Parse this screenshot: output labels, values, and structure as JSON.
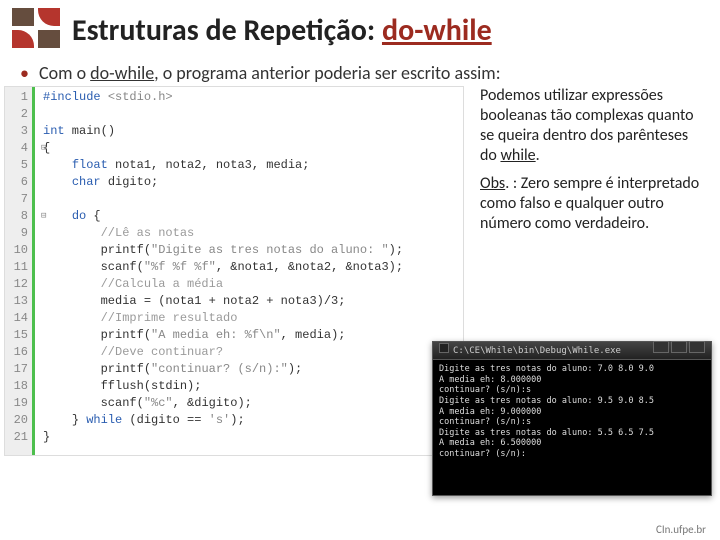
{
  "header": {
    "title_pre": "Estruturas de Repetição: ",
    "title_accent": "do-while"
  },
  "bullet": {
    "prefix": "Com o ",
    "kw": "do-while",
    "suffix": ", o programa anterior poderia ser escrito assim:"
  },
  "gutter": [
    "1",
    "2",
    "3",
    "4",
    "5",
    "6",
    "7",
    "8",
    "9",
    "10",
    "11",
    "12",
    "13",
    "14",
    "15",
    "16",
    "17",
    "18",
    "19",
    "20",
    "21"
  ],
  "code": {
    "l1a": "#include ",
    "l1b": "<stdio.h>",
    "l3": "int",
    "l3b": " main()",
    "l4": "{",
    "l5a": "float",
    "l5b": " nota1, nota2, nota3, media;",
    "l6a": "char",
    "l6b": " digito;",
    "l8a": "do",
    "l8b": " {",
    "l9": "//Lê as notas",
    "l10a": "printf(",
    "l10b": "\"Digite as tres notas do aluno: \"",
    "l10c": ");",
    "l11a": "scanf(",
    "l11b": "\"%f %f %f\"",
    "l11c": ", &nota1, &nota2, &nota3);",
    "l12": "//Calcula a média",
    "l13": "media = (nota1 + nota2 + nota3)/3;",
    "l14": "//Imprime resultado",
    "l15a": "printf(",
    "l15b": "\"A media eh: %f\\n\"",
    "l15c": ", media);",
    "l16": "//Deve continuar?",
    "l17a": "printf(",
    "l17b": "\"continuar? (s/n):\"",
    "l17c": ");",
    "l18": "fflush(stdin);",
    "l19a": "scanf(",
    "l19b": "\"%c\"",
    "l19c": ", &digito);",
    "l20a": "} ",
    "l20b": "while",
    "l20c": " (digito == ",
    "l20d": "'s'",
    "l20e": ");",
    "l21": "}"
  },
  "note": {
    "p1a": "Podemos utilizar expressões booleanas tão complexas quanto se queira dentro dos parênteses do ",
    "p1b": "while",
    "p1c": ".",
    "p2a": "Obs",
    "p2b": ". : Zero sempre é interpretado como falso e qualquer outro número como verdadeiro."
  },
  "terminal": {
    "title": "C:\\CE\\While\\bin\\Debug\\While.exe",
    "body": "Digite as tres notas do aluno: 7.0 8.0 9.0\nA media eh: 8.000000\ncontinuar? (s/n):s\nDigite as tres notas do aluno: 9.5 9.0 8.5\nA media eh: 9.000000\ncontinuar? (s/n):s\nDigite as tres notas do aluno: 5.5 6.5 7.5\nA media eh: 6.500000\ncontinuar? (s/n):"
  },
  "footer": "CIn.ufpe.br"
}
